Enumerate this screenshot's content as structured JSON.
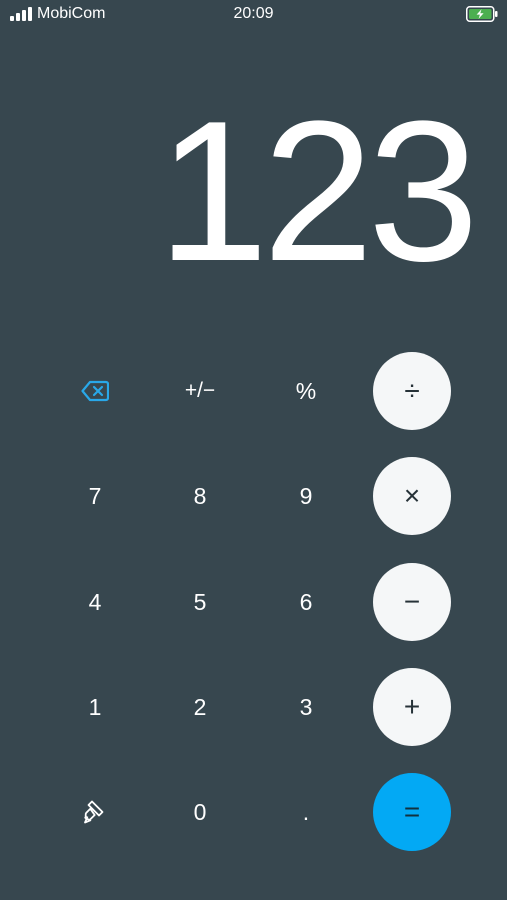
{
  "status_bar": {
    "carrier": "MobiCom",
    "time": "20:09",
    "signal_bars": 4,
    "battery_state": "charging",
    "battery_color": "#4caf50"
  },
  "display": {
    "value": "123"
  },
  "keypad": {
    "backspace_icon": "backspace-icon",
    "plus_minus": "+/−",
    "percent": "%",
    "divide": "÷",
    "seven": "7",
    "eight": "8",
    "nine": "9",
    "multiply": "×",
    "four": "4",
    "five": "5",
    "six": "6",
    "minus": "−",
    "one": "1",
    "two": "2",
    "three": "3",
    "plus": "+",
    "theme_icon": "paintbrush-icon",
    "zero": "0",
    "decimal": ".",
    "equals": "="
  },
  "colors": {
    "background": "#37474f",
    "accent": "#03a9f4",
    "operator_key": "#f5f7f8"
  }
}
